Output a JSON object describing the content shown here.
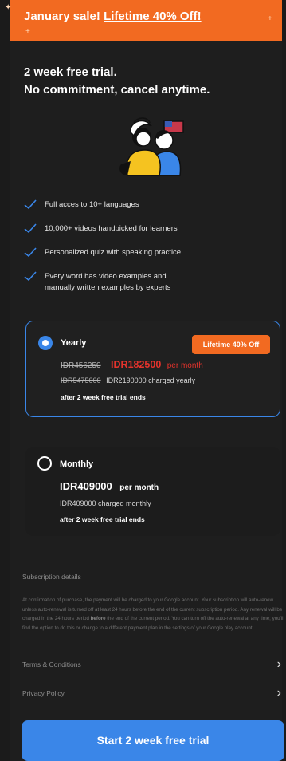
{
  "banner": {
    "prefix": "January sale! ",
    "highlight": "Lifetime 40% Off!"
  },
  "headline": {
    "line1": "2 week free trial.",
    "line2": "No commitment, cancel anytime."
  },
  "features": [
    "Full acces to 10+ languages",
    "10,000+ videos handpicked for learners",
    "Personalized quiz with speaking practice",
    "Every word has video examples and manually written examples by experts"
  ],
  "plans": {
    "yearly": {
      "name": "Yearly",
      "badge": "Lifetime 40% Off",
      "old_monthly": "IDR456250",
      "sale_monthly": "IDR182500",
      "per_month": "per month",
      "old_yearly": "IDR5475000",
      "charged": "IDR2190000 charged yearly",
      "note": "after 2 week free trial ends",
      "selected": true
    },
    "monthly": {
      "name": "Monthly",
      "price": "IDR409000",
      "per_month": "per month",
      "charged": "IDR409000 charged monthly",
      "note": "after 2 week free trial ends",
      "selected": false
    }
  },
  "details": {
    "title": "Subscription details",
    "body_part1": "At confirmation of purchase, the payment will be charged to your Google account. Your subscription will auto-renew unless auto-renewal is turned off at least 24 hours before the end of the current subscription period. Any renewal will be charged in the 24 hours period ",
    "body_bold": "before",
    "body_part2": " the end of the current period. You can turn off the auto-renewal at any time; you'll find the option to do this or change to a different payment plan in the settings of your Google play account."
  },
  "links": {
    "terms": "Terms & Conditions",
    "privacy": "Privacy Policy"
  },
  "cta": {
    "label": "Start 2 week free trial"
  },
  "colors": {
    "accent": "#3a86e8",
    "orange": "#f26a21",
    "sale_red": "#e4332c",
    "background": "#1b1b1b"
  }
}
